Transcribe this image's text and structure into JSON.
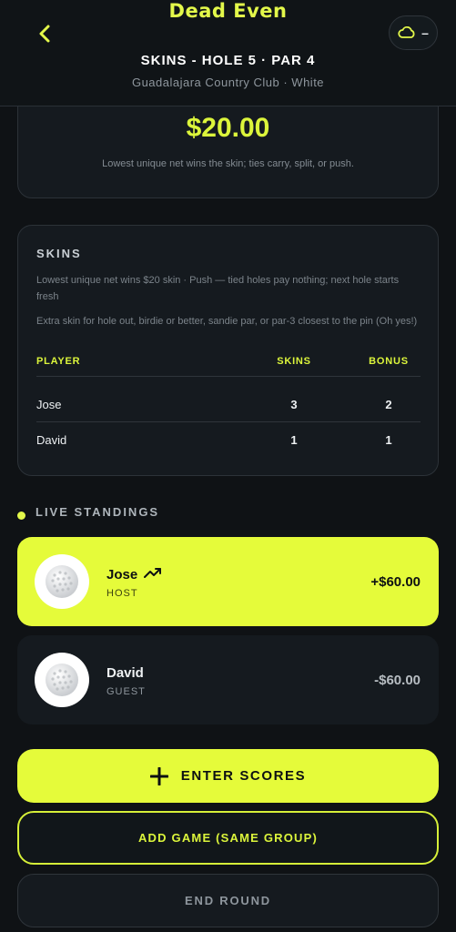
{
  "header": {
    "logo": "Dead Even",
    "title": "SKINS - HOLE 5 · PAR 4",
    "subtitle": "Guadalajara Country Club · White",
    "weather_value": "–"
  },
  "pot": {
    "amount": "$20.00",
    "description": "Lowest unique net wins the skin; ties carry, split, or push."
  },
  "skins": {
    "title": "SKINS",
    "rule1": "Lowest unique net wins $20 skin · Push — tied holes pay nothing; next hole starts fresh",
    "rule2": "Extra skin for hole out, birdie or better, sandie par, or par-3 closest to the pin (Oh yes!)",
    "columns": {
      "player": "PLAYER",
      "skins": "SKINS",
      "bonus": "BONUS"
    },
    "rows": [
      {
        "player": "Jose",
        "skins": "3",
        "bonus": "2"
      },
      {
        "player": "David",
        "skins": "1",
        "bonus": "1"
      }
    ]
  },
  "standings": {
    "label": "LIVE STANDINGS",
    "players": [
      {
        "name": "Jose",
        "role": "HOST",
        "amount": "+$60.00",
        "trend": "trending-up-icon"
      },
      {
        "name": "David",
        "role": "GUEST",
        "amount": "-$60.00"
      }
    ]
  },
  "actions": {
    "enter_scores": "ENTER SCORES",
    "add_game": "ADD GAME (SAME GROUP)",
    "end_round": "END ROUND"
  },
  "colors": {
    "accent": "#e5fb3a",
    "background": "#0f1215",
    "card": "#151a1f"
  }
}
